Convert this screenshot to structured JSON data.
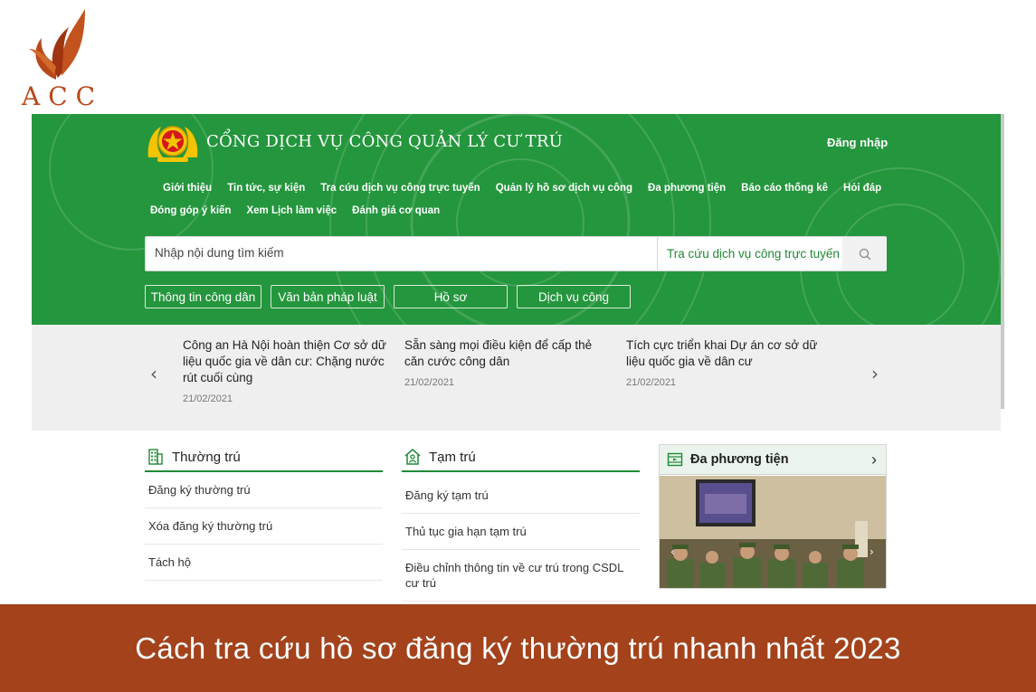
{
  "brand": {
    "logo_text": "ACC",
    "accent_color": "#b8471a"
  },
  "portal": {
    "title": "CỔNG DỊCH VỤ CÔNG QUẢN LÝ CƯ TRÚ",
    "login_label": "Đăng nhập",
    "header_color": "#24963d",
    "nav_row1": [
      "Giới thiệu",
      "Tin tức, sự kiện",
      "Tra cứu dịch vụ công trực tuyến",
      "Quản lý hồ sơ dịch vụ công",
      "Đa phương tiện",
      "Báo cáo thống kê",
      "Hỏi đáp"
    ],
    "nav_row2": [
      "Đóng góp ý kiến",
      "Xem Lịch làm việc",
      "Đánh giá cơ quan"
    ],
    "search": {
      "placeholder": "Nhập nội dung tìm kiếm",
      "scope_label": "Tra cứu dịch vụ công trực tuyến"
    },
    "tabs": [
      "Thông tin công dân",
      "Văn bản pháp luật",
      "Hồ sơ",
      "Dịch vụ công"
    ]
  },
  "news": [
    {
      "title": "Công an Hà Nội hoàn thiện Cơ sở dữ liệu quốc gia về dân cư: Chặng nước rút cuối cùng",
      "date": "21/02/2021"
    },
    {
      "title": "Sẵn sàng mọi điều kiện để cấp thẻ căn cước công dân",
      "date": "21/02/2021"
    },
    {
      "title": "Tích cực triển khai Dự án cơ sở dữ liệu quốc gia về dân cư",
      "date": "21/02/2021"
    }
  ],
  "thuong_tru": {
    "title": "Thường trú",
    "items": [
      "Đăng ký thường trú",
      "Xóa đăng ký thường trú",
      "Tách hộ"
    ]
  },
  "tam_tru": {
    "title": "Tạm trú",
    "items": [
      "Đăng ký tạm trú",
      "Thủ tục gia hạn tạm trú",
      "Điều chỉnh thông tin về cư trú trong CSDL cư trú"
    ]
  },
  "media": {
    "title": "Đa phương tiện"
  },
  "banner": {
    "text": "Cách tra cứu hồ sơ đăng ký thường trú nhanh nhất 2023",
    "color": "#a3421b"
  }
}
